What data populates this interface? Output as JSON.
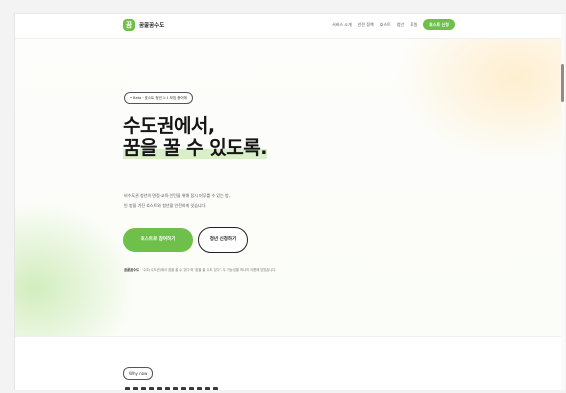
{
  "header": {
    "brand_logo": "꿈",
    "brand_name": "꿈꿀꿈수도",
    "nav": [
      "서비스 소개",
      "안전 정책",
      "호스트",
      "청년",
      "후원"
    ],
    "cta": "호스트 신청"
  },
  "hero": {
    "beta_pill": "• Beta · 호스트 청년 1:1 모집 중이에",
    "headline_line1": "수도권에서,",
    "headline_line2": "꿈을 꿀 수 있도록.",
    "desc_line1": "비수도권 청년의 면접·교육·인턴을 위해 잠시 머무를 수 있는 방,",
    "desc_line2": "빈 방을 가진 호스트와 청년을 안전하게 잇습니다.",
    "btn_primary": "호스트로 참여하기",
    "btn_secondary": "청년 신청하기",
    "note_bold": "꿈꿀꿈수도",
    "note_text": " · '수도(수도권)에서 꿈을 꿀 수 있다'와 '꿈을 꿀 수도 있다', 두 가능성을 하나의 이름에 담았습니다."
  },
  "why": {
    "pill": "Why now"
  },
  "colors": {
    "accent": "#6fbf4b",
    "highlight": "#d9efc7",
    "text": "#151515"
  }
}
